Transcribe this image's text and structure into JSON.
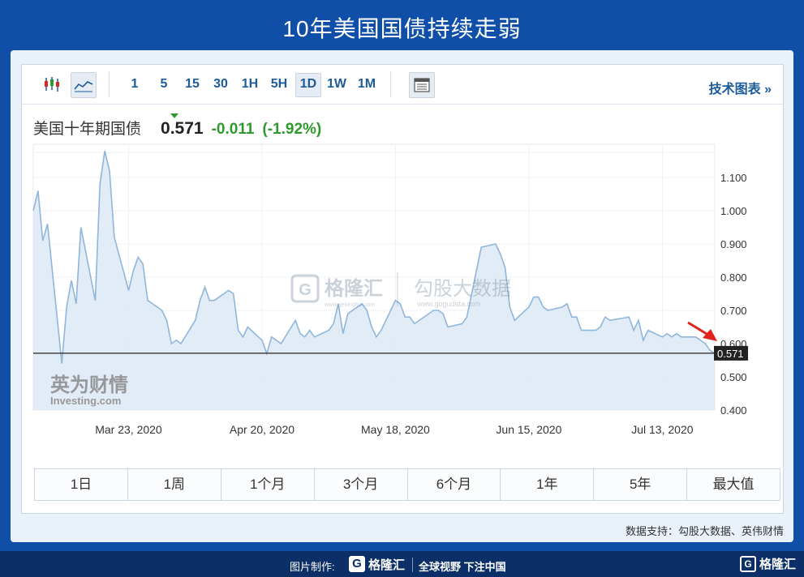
{
  "page_title": "10年美国国债持续走弱",
  "toolbar": {
    "intervals": [
      "1",
      "5",
      "15",
      "30",
      "1H",
      "5H",
      "1D",
      "1W",
      "1M"
    ],
    "active_interval": "1D",
    "tech_chart_label": "技术图表 »"
  },
  "quote": {
    "name": "美国十年期国债",
    "last": "0.571",
    "change": "-0.011",
    "change_pct": "(-1.92%)",
    "change_color": "#2e9a2e"
  },
  "watermarks": {
    "gelonghui_url": "www.gelonghui.com",
    "gelonghui_name": "格隆汇",
    "gogudata_name": "勾股大数据",
    "gogudata_url": "www.gogudata.com",
    "yingwei_name": "英为财情",
    "investing_name": "Investing.com"
  },
  "periods": [
    "1日",
    "1周",
    "1个月",
    "3个月",
    "6个月",
    "1年",
    "5年",
    "最大值"
  ],
  "source": "数据支持：勾股大数据、英伟财情",
  "footer": {
    "made_label": "图片制作:",
    "logo_name": "格隆汇",
    "slogan": "全球视野 下注中国",
    "brand": "格隆汇"
  },
  "colors": {
    "line": "#8fb6db",
    "area": "#dde9f4",
    "accent_blue": "#0f4fa8",
    "price_tag": "#222222",
    "annotation_arrow": "#e0231b"
  },
  "chart_data": {
    "type": "area",
    "title": "美国十年期国债",
    "x_tick_labels": [
      "Mar 23, 2020",
      "Apr 20, 2020",
      "May 18, 2020",
      "Jun 15, 2020",
      "Jul 13, 2020"
    ],
    "x_tick_dates": [
      "2020-03-23",
      "2020-04-20",
      "2020-05-18",
      "2020-06-15",
      "2020-07-13"
    ],
    "y_tick_labels": [
      "0.400",
      "0.500",
      "0.600",
      "0.700",
      "0.800",
      "0.900",
      "1.000",
      "1.100"
    ],
    "y_tick_values": [
      0.4,
      0.5,
      0.6,
      0.7,
      0.8,
      0.9,
      1.0,
      1.1
    ],
    "ylim": [
      0.4,
      1.2
    ],
    "xlim": [
      "2020-03-03",
      "2020-07-24"
    ],
    "current_value": 0.571,
    "current_label": "0.571",
    "grid": true,
    "series": [
      {
        "x": [
          "2020-03-03",
          "2020-03-04",
          "2020-03-05",
          "2020-03-06",
          "2020-03-09",
          "2020-03-10",
          "2020-03-11",
          "2020-03-12",
          "2020-03-13",
          "2020-03-16",
          "2020-03-17",
          "2020-03-18",
          "2020-03-19",
          "2020-03-20",
          "2020-03-23",
          "2020-03-24",
          "2020-03-25",
          "2020-03-26",
          "2020-03-27",
          "2020-03-30",
          "2020-03-31",
          "2020-04-01",
          "2020-04-02",
          "2020-04-03",
          "2020-04-06",
          "2020-04-07",
          "2020-04-08",
          "2020-04-09",
          "2020-04-10",
          "2020-04-13",
          "2020-04-14",
          "2020-04-15",
          "2020-04-16",
          "2020-04-17",
          "2020-04-20",
          "2020-04-21",
          "2020-04-22",
          "2020-04-23",
          "2020-04-24",
          "2020-04-27",
          "2020-04-28",
          "2020-04-29",
          "2020-04-30",
          "2020-05-01",
          "2020-05-04",
          "2020-05-05",
          "2020-05-06",
          "2020-05-07",
          "2020-05-08",
          "2020-05-11",
          "2020-05-12",
          "2020-05-13",
          "2020-05-14",
          "2020-05-15",
          "2020-05-18",
          "2020-05-19",
          "2020-05-20",
          "2020-05-21",
          "2020-05-22",
          "2020-05-26",
          "2020-05-27",
          "2020-05-28",
          "2020-05-29",
          "2020-06-01",
          "2020-06-02",
          "2020-06-03",
          "2020-06-04",
          "2020-06-05",
          "2020-06-08",
          "2020-06-09",
          "2020-06-10",
          "2020-06-11",
          "2020-06-12",
          "2020-06-15",
          "2020-06-16",
          "2020-06-17",
          "2020-06-18",
          "2020-06-19",
          "2020-06-22",
          "2020-06-23",
          "2020-06-24",
          "2020-06-25",
          "2020-06-26",
          "2020-06-29",
          "2020-06-30",
          "2020-07-01",
          "2020-07-02",
          "2020-07-06",
          "2020-07-07",
          "2020-07-08",
          "2020-07-09",
          "2020-07-10",
          "2020-07-13",
          "2020-07-14",
          "2020-07-15",
          "2020-07-16",
          "2020-07-17",
          "2020-07-20",
          "2020-07-21",
          "2020-07-22",
          "2020-07-23",
          "2020-07-24"
        ],
        "values": [
          1.0,
          1.06,
          0.91,
          0.96,
          0.54,
          0.71,
          0.79,
          0.72,
          0.95,
          0.73,
          1.08,
          1.18,
          1.12,
          0.92,
          0.76,
          0.82,
          0.86,
          0.84,
          0.73,
          0.7,
          0.67,
          0.6,
          0.61,
          0.6,
          0.67,
          0.73,
          0.77,
          0.73,
          0.73,
          0.76,
          0.75,
          0.64,
          0.62,
          0.65,
          0.61,
          0.57,
          0.62,
          0.61,
          0.6,
          0.67,
          0.63,
          0.62,
          0.64,
          0.62,
          0.64,
          0.66,
          0.72,
          0.63,
          0.69,
          0.72,
          0.7,
          0.65,
          0.62,
          0.64,
          0.73,
          0.72,
          0.68,
          0.68,
          0.66,
          0.7,
          0.7,
          0.69,
          0.65,
          0.66,
          0.68,
          0.75,
          0.82,
          0.89,
          0.9,
          0.87,
          0.83,
          0.71,
          0.67,
          0.71,
          0.74,
          0.74,
          0.71,
          0.7,
          0.71,
          0.72,
          0.68,
          0.68,
          0.64,
          0.64,
          0.65,
          0.68,
          0.67,
          0.68,
          0.64,
          0.67,
          0.61,
          0.64,
          0.62,
          0.63,
          0.62,
          0.63,
          0.62,
          0.62,
          0.61,
          0.6,
          0.58,
          0.57
        ]
      }
    ]
  }
}
